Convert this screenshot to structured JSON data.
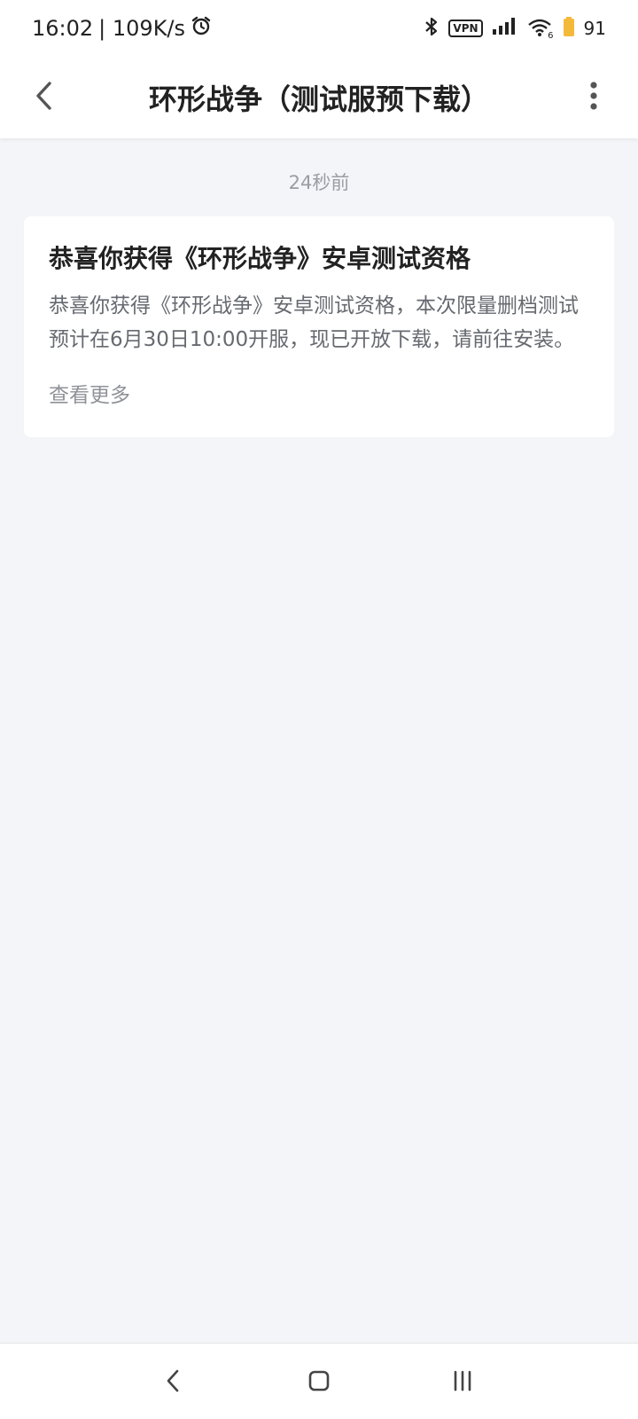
{
  "status_bar": {
    "time": "16:02",
    "speed": "| 109K/s",
    "vpn": "VPN",
    "wifi_sub": "6",
    "battery_level": "91",
    "icons": [
      "alarm-icon",
      "bluetooth-icon",
      "signal-icon",
      "wifi-icon",
      "battery-icon"
    ]
  },
  "header": {
    "title": "环形战争（测试服预下载）",
    "icons": [
      "back-arrow-icon",
      "more-vertical-icon"
    ]
  },
  "message": {
    "time_ago": "24秒前",
    "title": "恭喜你获得《环形战争》安卓测试资格",
    "body": "恭喜你获得《环形战争》安卓测试资格，本次限量删档测试预计在6月30日10:00开服，现已开放下载，请前往安装。",
    "more_label": "查看更多"
  },
  "nav_bar": {
    "icons": [
      "nav-back-icon",
      "nav-home-icon",
      "nav-recents-icon"
    ]
  },
  "colors": {
    "background": "#f4f5f8",
    "card": "#ffffff",
    "battery": "#f5b93a"
  }
}
